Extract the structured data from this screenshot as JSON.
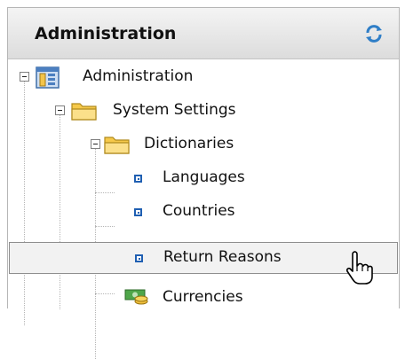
{
  "header": {
    "title": "Administration",
    "refresh_icon": "refresh-icon"
  },
  "tree": {
    "root": {
      "label": "Administration",
      "icon": "admin-icon"
    },
    "system_settings": {
      "label": "System Settings",
      "icon": "folder-open-icon"
    },
    "dictionaries": {
      "label": "Dictionaries",
      "icon": "folder-open-icon"
    },
    "leaves": [
      {
        "label": "Languages"
      },
      {
        "label": "Countries"
      },
      {
        "label": "Return Reasons"
      }
    ],
    "currencies": {
      "label": "Currencies",
      "icon": "currency-icon"
    }
  },
  "selected_item": "Return Reasons",
  "colors": {
    "accent": "#1f5fb2",
    "folder": "#f6c94a",
    "header_bg": "#e6e6e6"
  }
}
